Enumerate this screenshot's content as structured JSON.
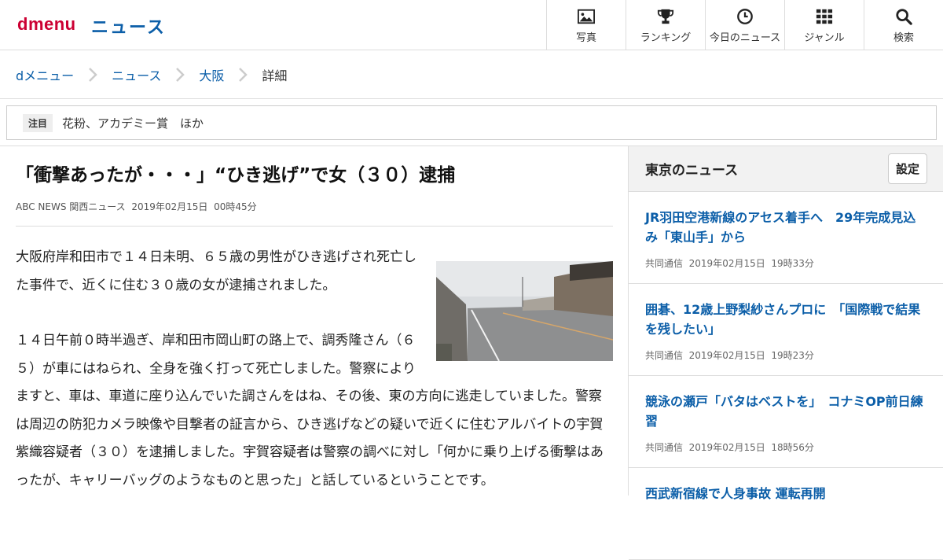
{
  "header": {
    "logo": "dmenu",
    "section_title": "ニュース",
    "nav": [
      {
        "label": "写真",
        "icon": "image-icon"
      },
      {
        "label": "ランキング",
        "icon": "trophy-icon"
      },
      {
        "label": "今日のニュース",
        "icon": "clock-icon"
      },
      {
        "label": "ジャンル",
        "icon": "grid-icon"
      },
      {
        "label": "検索",
        "icon": "search-icon"
      }
    ]
  },
  "breadcrumb": {
    "items": [
      "dメニュー",
      "ニュース",
      "大阪"
    ],
    "current": "詳細"
  },
  "attention": {
    "badge": "注目",
    "text": "花粉、アカデミー賞　ほか"
  },
  "article": {
    "title": "「衝撃あったが・・・」“ひき逃げ”で女（３０）逮捕",
    "source": "ABC NEWS 関西ニュース",
    "date": "2019年02月15日",
    "time": "00時45分",
    "paragraphs": [
      "大阪府岸和田市で１４日未明、６５歳の男性がひき逃げされ死亡した事件で、近くに住む３０歳の女が逮捕されました。",
      "１４日午前０時半過ぎ、岸和田市岡山町の路上で、調秀隆さん（６５）が車にはねられ、全身を強く打って死亡しました。警察によりますと、車は、車道に座り込んでいた調さんをはね、その後、東の方向に逃走していました。警察は周辺の防犯カメラ映像や目撃者の証言から、ひき逃げなどの疑いで近くに住むアルバイトの宇賀紫織容疑者（３０）を逮捕しました。宇賀容疑者は警察の調べに対し「何かに乗り上げる衝撃はあったが、キャリーバッグのようなものと思った」と話しているということです。"
    ]
  },
  "sidebar": {
    "title": "東京のニュース",
    "settings_label": "設定",
    "items": [
      {
        "title": "JR羽田空港新線のアセス着手へ　29年完成見込み「東山手」から",
        "source": "共同通信",
        "date": "2019年02月15日",
        "time": "19時33分"
      },
      {
        "title": "囲碁、12歳上野梨紗さんプロに　「国際戦で結果を残したい」",
        "source": "共同通信",
        "date": "2019年02月15日",
        "time": "19時23分"
      },
      {
        "title": "競泳の瀬戸「バタはベストを」　コナミOP前日練習",
        "source": "共同通信",
        "date": "2019年02月15日",
        "time": "18時56分"
      },
      {
        "title": "西武新宿線で人身事故 運転再開",
        "source": "",
        "date": "",
        "time": ""
      }
    ]
  },
  "colors": {
    "brand_red": "#cc0033",
    "link_blue": "#0b5ea8"
  }
}
